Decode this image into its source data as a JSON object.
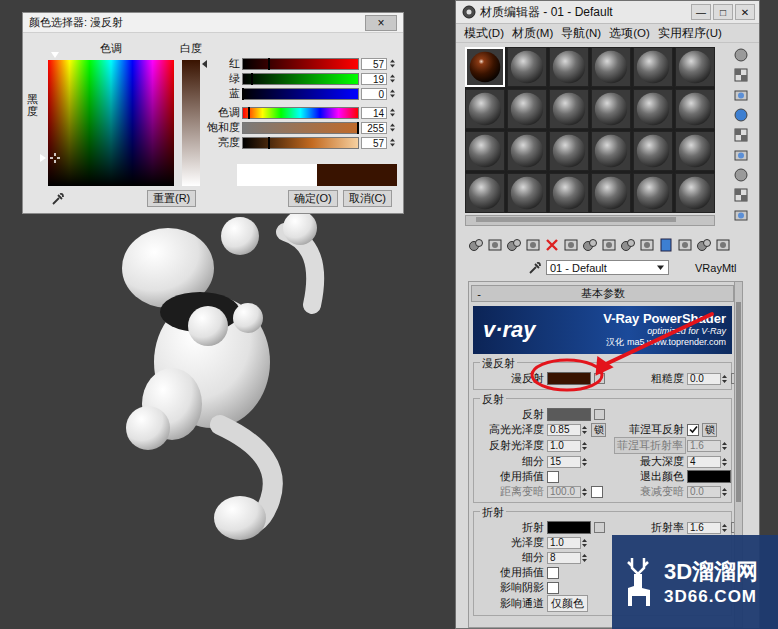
{
  "color_picker": {
    "title": "颜色选择器: 漫反射",
    "close": "×",
    "hue_label": "色调",
    "whiteness_label": "白度",
    "blackness_label": "黑度",
    "hue_level": 0.055,
    "blackness_level": 0.78,
    "whiteness_level": 0,
    "channels": [
      {
        "label": "红",
        "value": "57",
        "level": 0.224
      },
      {
        "label": "绿",
        "value": "19",
        "level": 0.075
      },
      {
        "label": "蓝",
        "value": "0",
        "level": 0
      },
      {
        "label": "色调",
        "value": "14",
        "level": 0.055
      },
      {
        "label": "饱和度",
        "value": "255",
        "level": 1
      },
      {
        "label": "亮度",
        "value": "57",
        "level": 0.224
      }
    ],
    "original_color": "#ffffff",
    "new_color": "#391300",
    "reset": "重置(R)",
    "ok": "确定(O)",
    "cancel": "取消(C)"
  },
  "material_editor": {
    "title": "材质编辑器 - 01 - Default",
    "window_buttons": [
      "—",
      "□",
      "✕"
    ],
    "menu": [
      "模式(D)",
      "材质(M)",
      "导航(N)",
      "选项(O)",
      "实用程序(U)"
    ],
    "slots": [
      {
        "selected": true
      },
      {
        "selected": false
      },
      {
        "selected": false
      },
      {
        "selected": false
      },
      {
        "selected": false
      },
      {
        "selected": false
      },
      {
        "selected": false
      },
      {
        "selected": false
      },
      {
        "selected": false
      },
      {
        "selected": false
      },
      {
        "selected": false
      },
      {
        "selected": false
      },
      {
        "selected": false
      },
      {
        "selected": false
      },
      {
        "selected": false
      },
      {
        "selected": false
      },
      {
        "selected": false
      },
      {
        "selected": false
      },
      {
        "selected": false
      },
      {
        "selected": false
      },
      {
        "selected": false
      },
      {
        "selected": false
      },
      {
        "selected": false
      },
      {
        "selected": false
      }
    ],
    "material_name": "01 - Default",
    "material_type": "VRayMtl",
    "rollout": {
      "toggle": "-",
      "title": "基本参数"
    },
    "banner": {
      "logo": "v·ray",
      "title": "V-Ray PowerShader",
      "subtitle": "optimized for V-Ray",
      "credit": "汉化 ma5 www.toprender.com"
    },
    "groups": [
      {
        "title": "漫反射",
        "rows": [
          {
            "left": {
              "label": "漫反射",
              "kind": "swatch",
              "color": "#391300",
              "disabled": false
            },
            "right": {
              "label": "粗糙度",
              "kind": "spinner-map",
              "value": "0.0",
              "disabled": false
            }
          }
        ]
      },
      {
        "title": "反射",
        "rows": [
          {
            "left": {
              "label": "反射",
              "kind": "swatch",
              "color": "#5a5a5a",
              "disabled": false
            },
            "right": null
          },
          {
            "left": {
              "label": "高光光泽度",
              "kind": "spinner-lock",
              "value": "0.85",
              "lock": "锁",
              "disabled": false
            },
            "right": {
              "label": "菲涅耳反射",
              "kind": "check-lock",
              "checked": true,
              "lock": "锁",
              "disabled": false
            }
          },
          {
            "left": {
              "label": "反射光泽度",
              "kind": "spinner",
              "value": "1.0",
              "disabled": false
            },
            "right": {
              "label": "菲涅耳折射率",
              "kind": "spinner-button",
              "value": "1.6",
              "disabled": true
            }
          },
          {
            "left": {
              "label": "细分",
              "kind": "spinner",
              "value": "15",
              "disabled": false
            },
            "right": {
              "label": "最大深度",
              "kind": "spinner",
              "value": "4",
              "disabled": false
            }
          },
          {
            "left": {
              "label": "使用插值",
              "kind": "check",
              "checked": false,
              "disabled": false
            },
            "right": {
              "label": "退出颜色",
              "kind": "swatch-plain",
              "color": "#000000",
              "disabled": false
            }
          },
          {
            "left": {
              "label": "距离变暗",
              "kind": "spinner-check",
              "value": "100.0",
              "checked": false,
              "disabled": true
            },
            "right": {
              "label": "衰减变暗",
              "kind": "spinner",
              "value": "0.0",
              "disabled": true
            }
          }
        ]
      },
      {
        "title": "折射",
        "rows": [
          {
            "left": {
              "label": "折射",
              "kind": "swatch",
              "color": "#000000",
              "disabled": false
            },
            "right": {
              "label": "折射率",
              "kind": "spinner-map",
              "value": "1.6",
              "disabled": false
            }
          },
          {
            "left": {
              "label": "光泽度",
              "kind": "spinner",
              "value": "1.0",
              "disabled": false
            },
            "right": null
          },
          {
            "left": {
              "label": "细分",
              "kind": "spinner",
              "value": "8",
              "disabled": false
            },
            "right": null
          },
          {
            "left": {
              "label": "使用插值",
              "kind": "check",
              "checked": false,
              "disabled": false
            },
            "right": null
          },
          {
            "left": {
              "label": "影响阴影",
              "kind": "check",
              "checked": false,
              "disabled": false
            },
            "right": null
          },
          {
            "left": {
              "label": "影响通道",
              "kind": "dropdown",
              "value": "仅颜色",
              "disabled": false
            },
            "right": null
          }
        ]
      }
    ]
  },
  "watermark": {
    "title": "3D溜溜网",
    "subtitle": "3D66.COM"
  }
}
